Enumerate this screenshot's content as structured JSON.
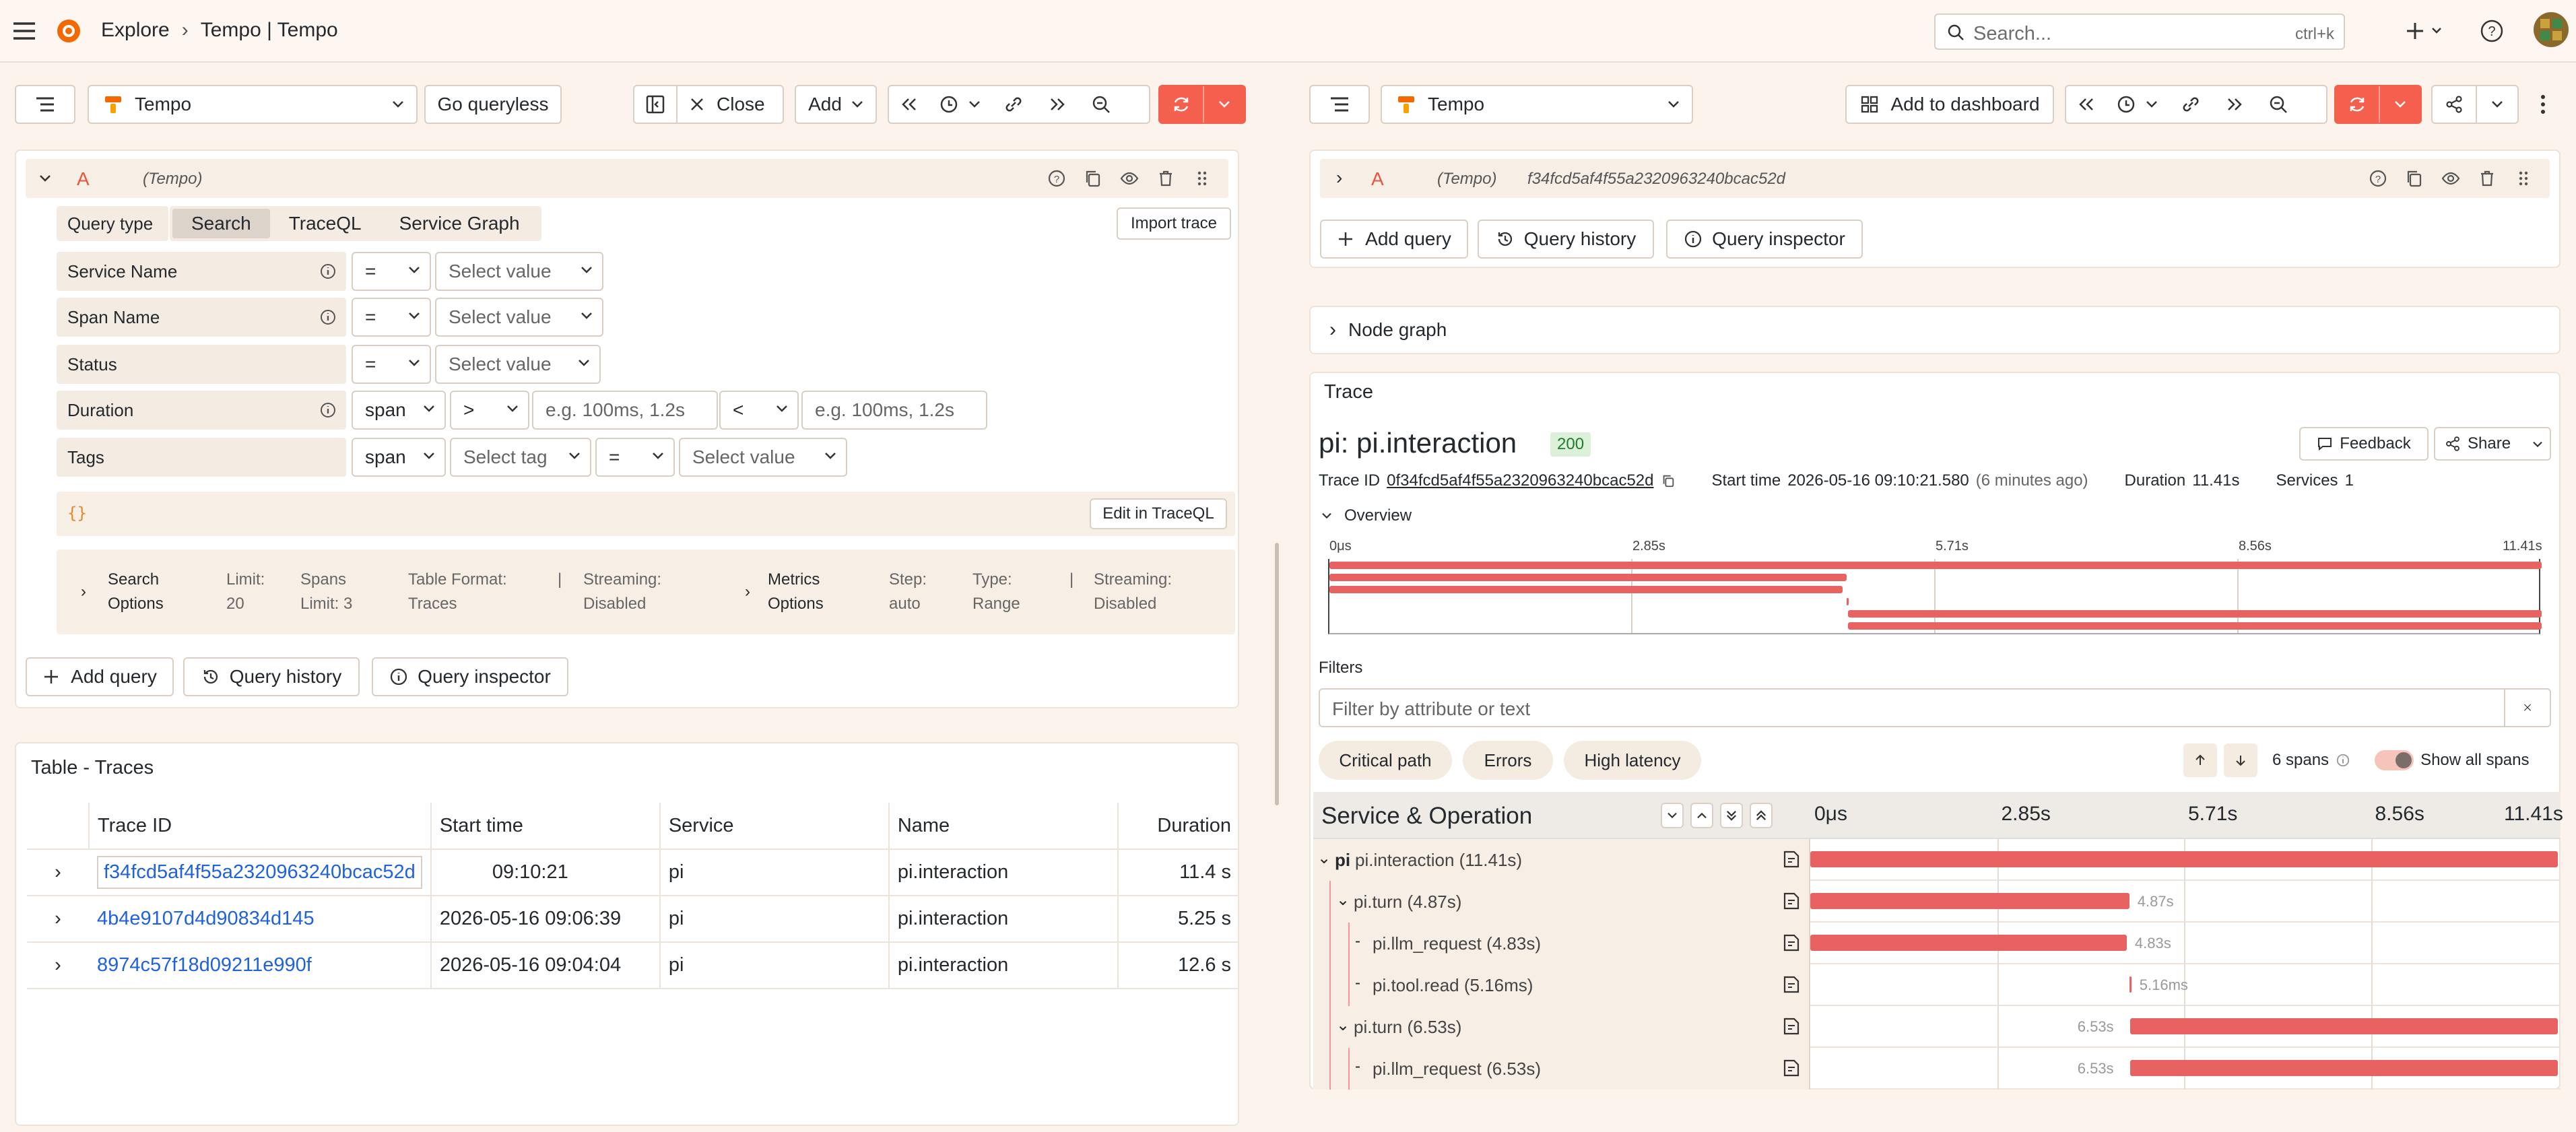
{
  "app": {
    "breadcrumb": [
      "Explore",
      "Tempo | Tempo"
    ],
    "search_placeholder": "Search...",
    "search_shortcut": "ctrl+k",
    "accent": "#f55f4e"
  },
  "left": {
    "datasource": "Tempo",
    "go_queryless": "Go queryless",
    "close": "Close",
    "add": "Add",
    "query": {
      "letter": "A",
      "source": "(Tempo)",
      "query_type_label": "Query type",
      "tabs": [
        "Search",
        "TraceQL",
        "Service Graph"
      ],
      "import_trace": "Import trace",
      "rows": [
        {
          "label": "Service Name",
          "op": "=",
          "value": "Select value"
        },
        {
          "label": "Span Name",
          "op": "=",
          "value": "Select value"
        },
        {
          "label": "Status",
          "op": "=",
          "value": "Select value"
        },
        {
          "label": "Duration",
          "scope": "span",
          "op1": ">",
          "ph1": "e.g. 100ms, 1.2s",
          "op2": "<",
          "ph2": "e.g. 100ms, 1.2s"
        },
        {
          "label": "Tags",
          "scope": "span",
          "tag": "Select tag",
          "op": "=",
          "value": "Select value"
        }
      ],
      "braces": "{}",
      "edit_traceql": "Edit in TraceQL",
      "options": {
        "search_title": [
          "Search",
          "Options"
        ],
        "limit": [
          "Limit:",
          "20"
        ],
        "spans_limit": [
          "Spans",
          "Limit: 3"
        ],
        "table_format": [
          "Table Format:",
          "Traces"
        ],
        "streaming1": [
          "Streaming:",
          "Disabled"
        ],
        "metrics_title": [
          "Metrics",
          "Options"
        ],
        "step": [
          "Step:",
          "auto"
        ],
        "type": [
          "Type:",
          "Range"
        ],
        "streaming2": [
          "Streaming:",
          "Disabled"
        ]
      }
    },
    "add_query": "Add query",
    "query_history": "Query history",
    "query_inspector": "Query inspector",
    "table": {
      "title": "Table - Traces",
      "columns": [
        "Trace ID",
        "Start time",
        "Service",
        "Name",
        "Duration"
      ],
      "rows": [
        {
          "id": "f34fcd5af4f55a2320963240bcac52d",
          "start": "09:10:21",
          "service": "pi",
          "name": "pi.interaction",
          "duration": "11.4 s"
        },
        {
          "id": "4b4e9107d4d90834d145",
          "start": "2026-05-16 09:06:39",
          "service": "pi",
          "name": "pi.interaction",
          "duration": "5.25 s"
        },
        {
          "id": "8974c57f18d09211e990f",
          "start": "2026-05-16 09:04:04",
          "service": "pi",
          "name": "pi.interaction",
          "duration": "12.6 s"
        }
      ]
    }
  },
  "right": {
    "datasource": "Tempo",
    "add_to_dashboard": "Add to dashboard",
    "query": {
      "letter": "A",
      "source": "(Tempo)",
      "trace_id": "f34fcd5af4f55a2320963240bcac52d"
    },
    "add_query": "Add query",
    "query_history": "Query history",
    "query_inspector": "Query inspector",
    "node_graph": "Node graph",
    "trace": {
      "section": "Trace",
      "title": "pi: pi.interaction",
      "status": "200",
      "feedback": "Feedback",
      "share": "Share",
      "trace_id_label": "Trace ID",
      "trace_id": "0f34fcd5af4f55a2320963240bcac52d",
      "start_label": "Start time",
      "start_value": "2026-05-16 09:10:21.580",
      "start_rel": "(6 minutes ago)",
      "duration_label": "Duration",
      "duration_value": "11.41s",
      "services_label": "Services",
      "services_value": "1",
      "overview": "Overview",
      "ticks": [
        "0μs",
        "2.85s",
        "5.71s",
        "8.56s",
        "11.41s"
      ],
      "filters": "Filters",
      "filter_placeholder": "Filter by attribute or text",
      "chips": [
        "Critical path",
        "Errors",
        "High latency"
      ],
      "span_count": "6 spans",
      "show_all": "Show all spans",
      "col_header": "Service & Operation",
      "spans": [
        {
          "service": "pi",
          "name": "pi.interaction (11.41s)",
          "depth": 0,
          "start": 0,
          "dur": 11.41,
          "label": ""
        },
        {
          "service": "",
          "name": "pi.turn (4.87s)",
          "depth": 1,
          "start": 0,
          "dur": 4.87,
          "label": "4.87s"
        },
        {
          "service": "",
          "name": "pi.llm_request (4.83s)",
          "depth": 2,
          "start": 0,
          "dur": 4.83,
          "label": "4.83s"
        },
        {
          "service": "",
          "name": "pi.tool.read (5.16ms)",
          "depth": 2,
          "start": 4.87,
          "dur": 0.005,
          "label": "5.16ms"
        },
        {
          "service": "",
          "name": "pi.turn (6.53s)",
          "depth": 1,
          "start": 4.88,
          "dur": 6.53,
          "label": "6.53s"
        },
        {
          "service": "",
          "name": "pi.llm_request (6.53s)",
          "depth": 2,
          "start": 4.88,
          "dur": 6.53,
          "label": "6.53s"
        }
      ]
    }
  }
}
